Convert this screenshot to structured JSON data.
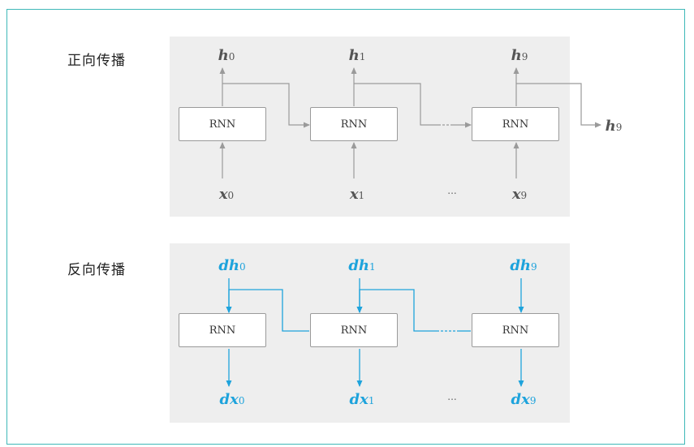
{
  "forward": {
    "title": "正向传播",
    "cells": [
      {
        "box": "RNN",
        "h": "h",
        "h_sub": "0",
        "x": "x",
        "x_sub": "0"
      },
      {
        "box": "RNN",
        "h": "h",
        "h_sub": "1",
        "x": "x",
        "x_sub": "1"
      },
      {
        "box": "RNN",
        "h": "h",
        "h_sub": "9",
        "x": "x",
        "x_sub": "9"
      }
    ],
    "ellipsis": "...",
    "final_output": "h",
    "final_output_sub": "9"
  },
  "backward": {
    "title": "反向传播",
    "cells": [
      {
        "box": "RNN",
        "dh": "dh",
        "dh_sub": "0",
        "dx": "dx",
        "dx_sub": "0"
      },
      {
        "box": "RNN",
        "dh": "dh",
        "dh_sub": "1",
        "dx": "dx",
        "dx_sub": "1"
      },
      {
        "box": "RNN",
        "dh": "dh",
        "dh_sub": "9",
        "dx": "dx",
        "dx_sub": "9"
      }
    ],
    "ellipsis": "..."
  },
  "colors": {
    "forward_arrow": "#9a9a9a",
    "backward_arrow": "#1ea3dc",
    "frame_border": "#3fb8b8"
  }
}
